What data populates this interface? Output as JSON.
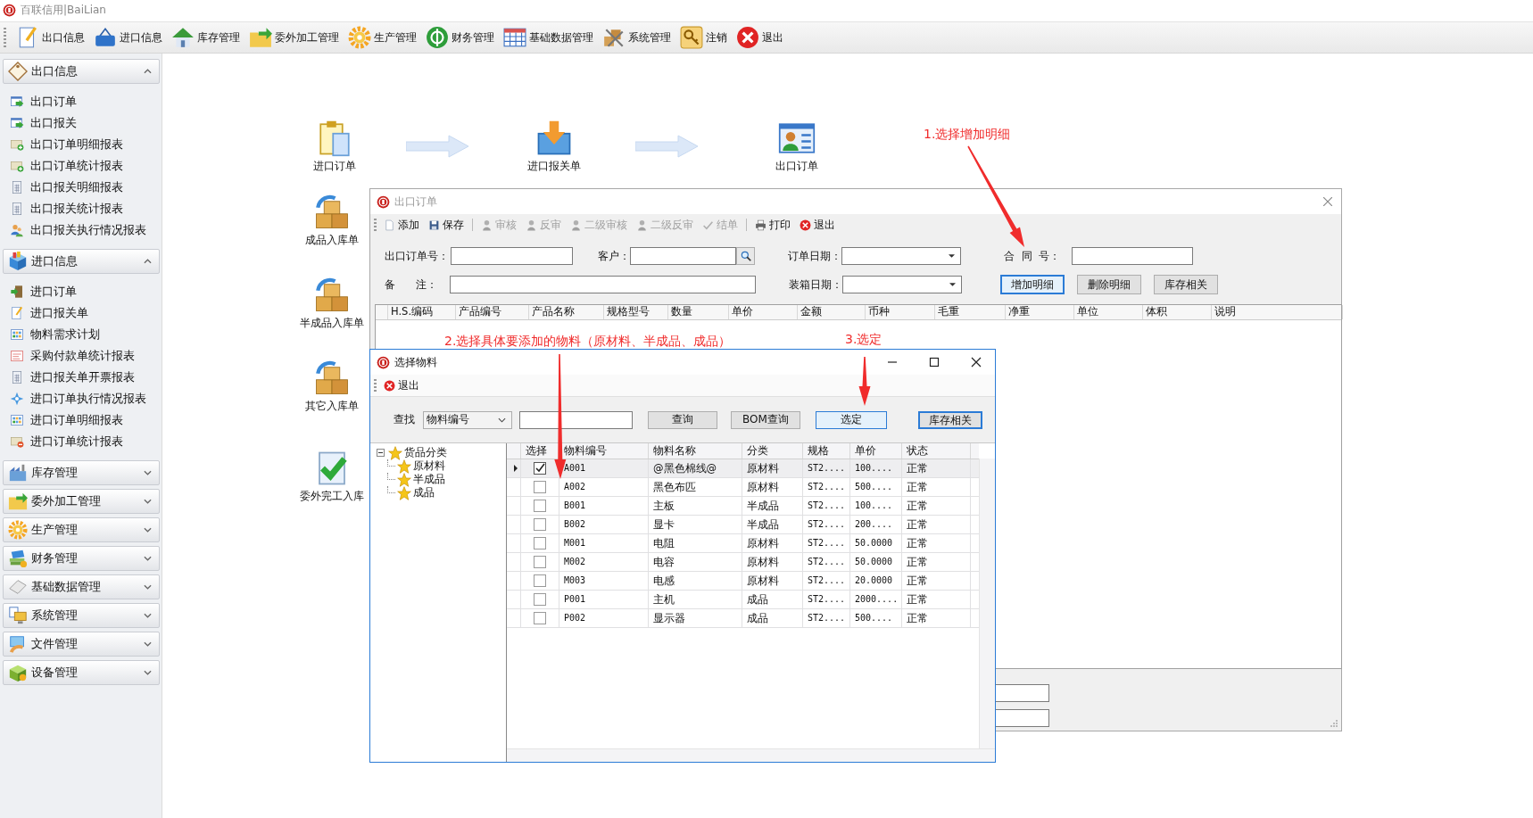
{
  "app": {
    "title": "百联信用|BaiLian"
  },
  "toolbar": [
    {
      "label": "出口信息"
    },
    {
      "label": "进口信息"
    },
    {
      "label": "库存管理"
    },
    {
      "label": "委外加工管理"
    },
    {
      "label": "生产管理"
    },
    {
      "label": "财务管理"
    },
    {
      "label": "基础数据管理"
    },
    {
      "label": "系统管理"
    },
    {
      "label": "注销"
    },
    {
      "label": "退出"
    }
  ],
  "sidebar": [
    {
      "label": "出口信息",
      "expanded": true,
      "items": [
        "出口订单",
        "出口报关",
        "出口订单明细报表",
        "出口订单统计报表",
        "出口报关明细报表",
        "出口报关统计报表",
        "出口报关执行情况报表"
      ]
    },
    {
      "label": "进口信息",
      "expanded": true,
      "items": [
        "进口订单",
        "进口报关单",
        "物料需求计划",
        "采购付款单统计报表",
        "进口报关单开票报表",
        "进口订单执行情况报表",
        "进口订单明细报表",
        "进口订单统计报表"
      ]
    },
    {
      "label": "库存管理",
      "expanded": false
    },
    {
      "label": "委外加工管理",
      "expanded": false
    },
    {
      "label": "生产管理",
      "expanded": false
    },
    {
      "label": "财务管理",
      "expanded": false
    },
    {
      "label": "基础数据管理",
      "expanded": false
    },
    {
      "label": "系统管理",
      "expanded": false
    },
    {
      "label": "文件管理",
      "expanded": false
    },
    {
      "label": "设备管理",
      "expanded": false
    }
  ],
  "flow": {
    "steps": [
      "进口订单",
      "进口报关单",
      "出口订单"
    ],
    "receipts": [
      "成品入库单",
      "半成品入库单",
      "其它入库单",
      "委外完工入库"
    ]
  },
  "annotations": [
    "1.选择增加明细",
    "2.选择具体要添加的物料（原材料、半成品、成品）",
    "3.选定"
  ],
  "order_window": {
    "title": "出口订单",
    "active": false,
    "toolbar": [
      {
        "kind": "button",
        "label": "添加",
        "disabled": false
      },
      {
        "kind": "button",
        "label": "保存",
        "disabled": false
      },
      {
        "kind": "separator"
      },
      {
        "kind": "button",
        "label": "审核",
        "disabled": true
      },
      {
        "kind": "button",
        "label": "反审",
        "disabled": true
      },
      {
        "kind": "button",
        "label": "二级审核",
        "disabled": true
      },
      {
        "kind": "button",
        "label": "二级反审",
        "disabled": true
      },
      {
        "kind": "button",
        "label": "结单",
        "disabled": true
      },
      {
        "kind": "separator"
      },
      {
        "kind": "button",
        "label": "打印",
        "disabled": false
      },
      {
        "kind": "button",
        "label": "退出",
        "disabled": false
      }
    ],
    "order_no_label": "出口订单号：",
    "customer_label": "客户：",
    "order_date_label": "订单日期：",
    "contract_label": "合  同  号：",
    "remark_label": "备      注：",
    "packing_date_label": "装箱日期：",
    "buttons": [
      {
        "label": "增加明细",
        "focused": true
      },
      {
        "label": "删除明细",
        "focused": false
      },
      {
        "label": "库存相关",
        "focused": false
      }
    ],
    "columns": [
      "H.S.编码",
      "产品编号",
      "产品名称",
      "规格型号",
      "数量",
      "单价",
      "金额",
      "币种",
      "毛重",
      "净重",
      "单位",
      "体积",
      "说明"
    ]
  },
  "material_dialog": {
    "title": "选择物料",
    "active": true,
    "toolbar": [
      {
        "label": "退出"
      }
    ],
    "search_label": "查找",
    "search_by": "物料编号",
    "buttons": [
      {
        "label": "查询",
        "kind": "normal"
      },
      {
        "label": "BOM查询",
        "kind": "normal"
      },
      {
        "label": "选定",
        "kind": "hover"
      },
      {
        "label": "库存相关",
        "kind": "default"
      }
    ],
    "tree": {
      "label": "货品分类",
      "expanded": true,
      "children": [
        {
          "label": "原材料"
        },
        {
          "label": "半成品"
        },
        {
          "label": "成品"
        }
      ]
    },
    "columns": [
      "选择",
      "物料编号",
      "物料名称",
      "分类",
      "规格",
      "单价",
      "状态"
    ],
    "rows": [
      {
        "current": true,
        "checked": true,
        "code": "A001",
        "name": "@黑色棉线@",
        "category": "原材料",
        "spec": "ST2....",
        "price": "100....",
        "status": "正常"
      },
      {
        "current": false,
        "checked": false,
        "code": "A002",
        "name": "黑色布匹",
        "category": "原材料",
        "spec": "ST2....",
        "price": "500....",
        "status": "正常"
      },
      {
        "current": false,
        "checked": false,
        "code": "B001",
        "name": "主板",
        "category": "半成品",
        "spec": "ST2....",
        "price": "100....",
        "status": "正常"
      },
      {
        "current": false,
        "checked": false,
        "code": "B002",
        "name": "显卡",
        "category": "半成品",
        "spec": "ST2....",
        "price": "200....",
        "status": "正常"
      },
      {
        "current": false,
        "checked": false,
        "code": "M001",
        "name": "电阻",
        "category": "原材料",
        "spec": "ST2....",
        "price": "50.0000",
        "status": "正常"
      },
      {
        "current": false,
        "checked": false,
        "code": "M002",
        "name": "电容",
        "category": "原材料",
        "spec": "ST2....",
        "price": "50.0000",
        "status": "正常"
      },
      {
        "current": false,
        "checked": false,
        "code": "M003",
        "name": "电感",
        "category": "原材料",
        "spec": "ST2....",
        "price": "20.0000",
        "status": "正常"
      },
      {
        "current": false,
        "checked": false,
        "code": "P001",
        "name": "主机",
        "category": "成品",
        "spec": "ST2....",
        "price": "2000....",
        "status": "正常"
      },
      {
        "current": false,
        "checked": false,
        "code": "P002",
        "name": "显示器",
        "category": "成品",
        "spec": "ST2....",
        "price": "500....",
        "status": "正常"
      }
    ]
  }
}
